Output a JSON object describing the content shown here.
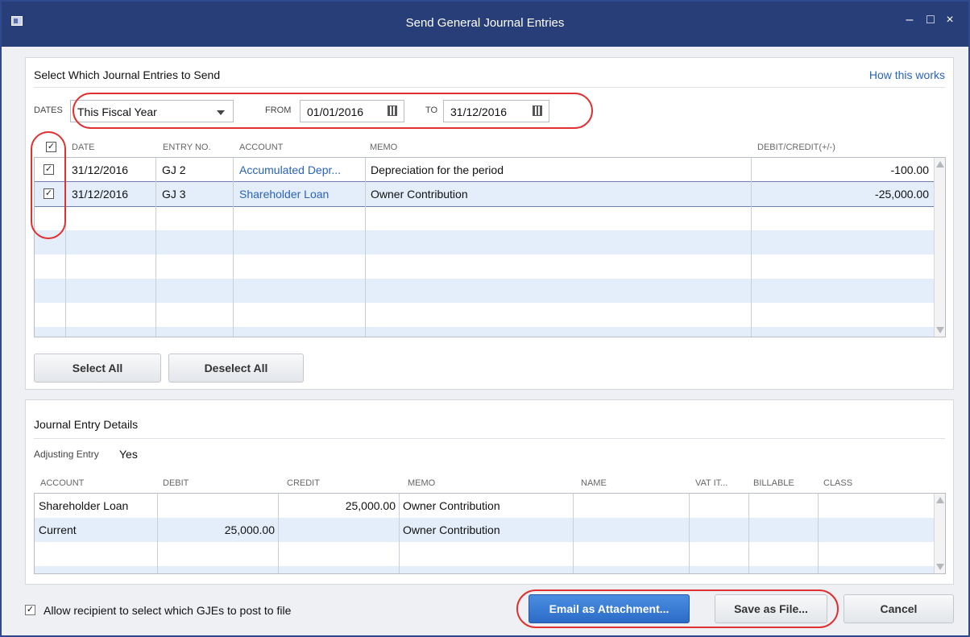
{
  "window": {
    "title": "Send General Journal Entries",
    "controls": {
      "minimize": "–",
      "maximize": "□",
      "close": "×"
    }
  },
  "select_section": {
    "title": "Select Which Journal Entries to Send",
    "help_link": "How this works",
    "dates_label": "DATES",
    "dates_value": "This Fiscal Year",
    "from_label": "FROM",
    "from_value": "01/01/2016",
    "to_label": "TO",
    "to_value": "31/12/2016"
  },
  "entries_table": {
    "columns": [
      "DATE",
      "ENTRY NO.",
      "ACCOUNT",
      "MEMO",
      "DEBIT/CREDIT(+/-)"
    ],
    "header_checked": true,
    "rows": [
      {
        "checked": true,
        "date": "31/12/2016",
        "entry_no": "GJ 2",
        "account": "Accumulated Depr...",
        "memo": "Depreciation for the period",
        "amount": "-100.00"
      },
      {
        "checked": true,
        "date": "31/12/2016",
        "entry_no": "GJ 3",
        "account": "Shareholder Loan",
        "memo": "Owner Contribution",
        "amount": "-25,000.00"
      }
    ]
  },
  "buttons": {
    "select_all": "Select All",
    "deselect_all": "Deselect All",
    "email": "Email as Attachment...",
    "save_file": "Save as File...",
    "cancel": "Cancel"
  },
  "details_section": {
    "title": "Journal Entry Details",
    "adjusting_label": "Adjusting Entry",
    "adjusting_value": "Yes",
    "columns": [
      "ACCOUNT",
      "DEBIT",
      "CREDIT",
      "MEMO",
      "NAME",
      "VAT IT...",
      "BILLABLE",
      "CLASS"
    ],
    "rows": [
      {
        "account": "Shareholder Loan",
        "debit": "",
        "credit": "25,000.00",
        "memo": "Owner Contribution"
      },
      {
        "account": "Current",
        "debit": "25,000.00",
        "credit": "",
        "memo": "Owner Contribution"
      }
    ]
  },
  "footer": {
    "allow_recipient_label": "Allow recipient to select which GJEs to post to file",
    "allow_recipient_checked": true
  },
  "colors": {
    "titlebar": "#283e78",
    "link": "#2a63b8",
    "highlight": "#e03030",
    "primary_button": "#2c6cc8"
  }
}
